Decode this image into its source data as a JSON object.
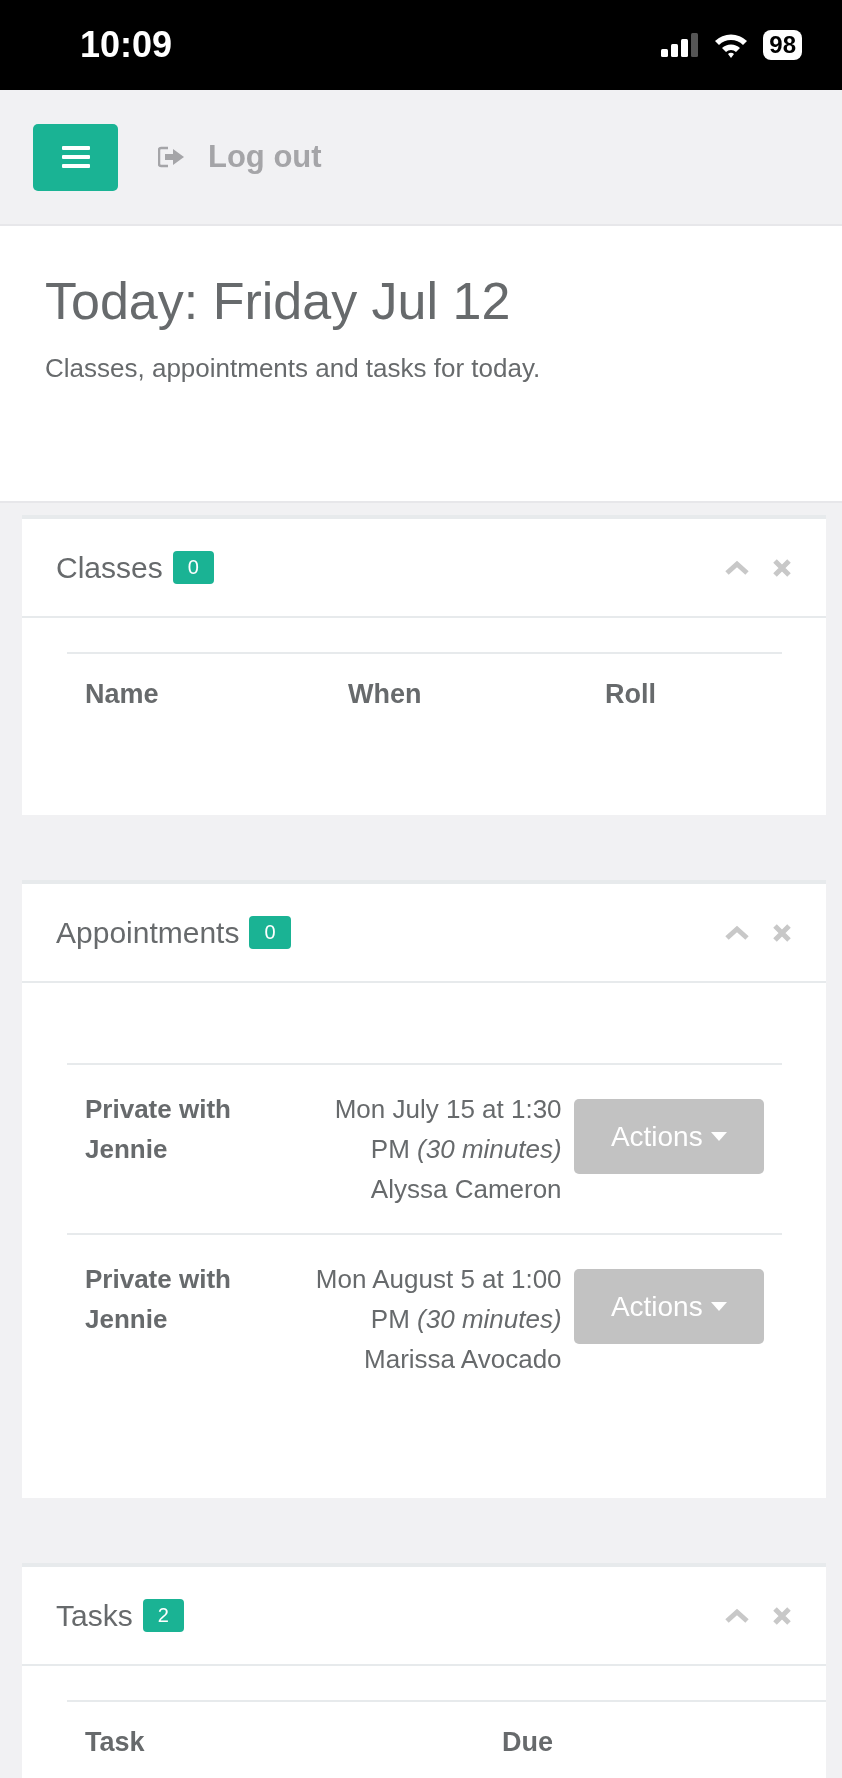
{
  "status_bar": {
    "time": "10:09",
    "battery": "98"
  },
  "nav": {
    "logout": "Log out"
  },
  "header": {
    "title": "Today: Friday Jul 12",
    "subtitle": "Classes, appointments and tasks for today."
  },
  "panels": [
    {
      "kind": "table",
      "title": "Classes",
      "count": "0",
      "columns": [
        "Name",
        "When",
        "Roll"
      ]
    },
    {
      "kind": "list",
      "title": "Appointments",
      "count": "0",
      "rows": [
        {
          "name": "Private with Jennie",
          "when": "Mon July 15 at 1:30 PM *(30 minutes)*",
          "client": "Alyssa Cameron",
          "button": "Actions"
        },
        {
          "name": "Private with Jennie",
          "when": "Mon August 5 at 1:00 PM *(30 minutes)*",
          "client": "Marissa Avocado",
          "button": "Actions"
        }
      ]
    },
    {
      "kind": "table",
      "title": "Tasks",
      "count": "2",
      "columns": [
        "Task",
        "Due"
      ]
    }
  ]
}
